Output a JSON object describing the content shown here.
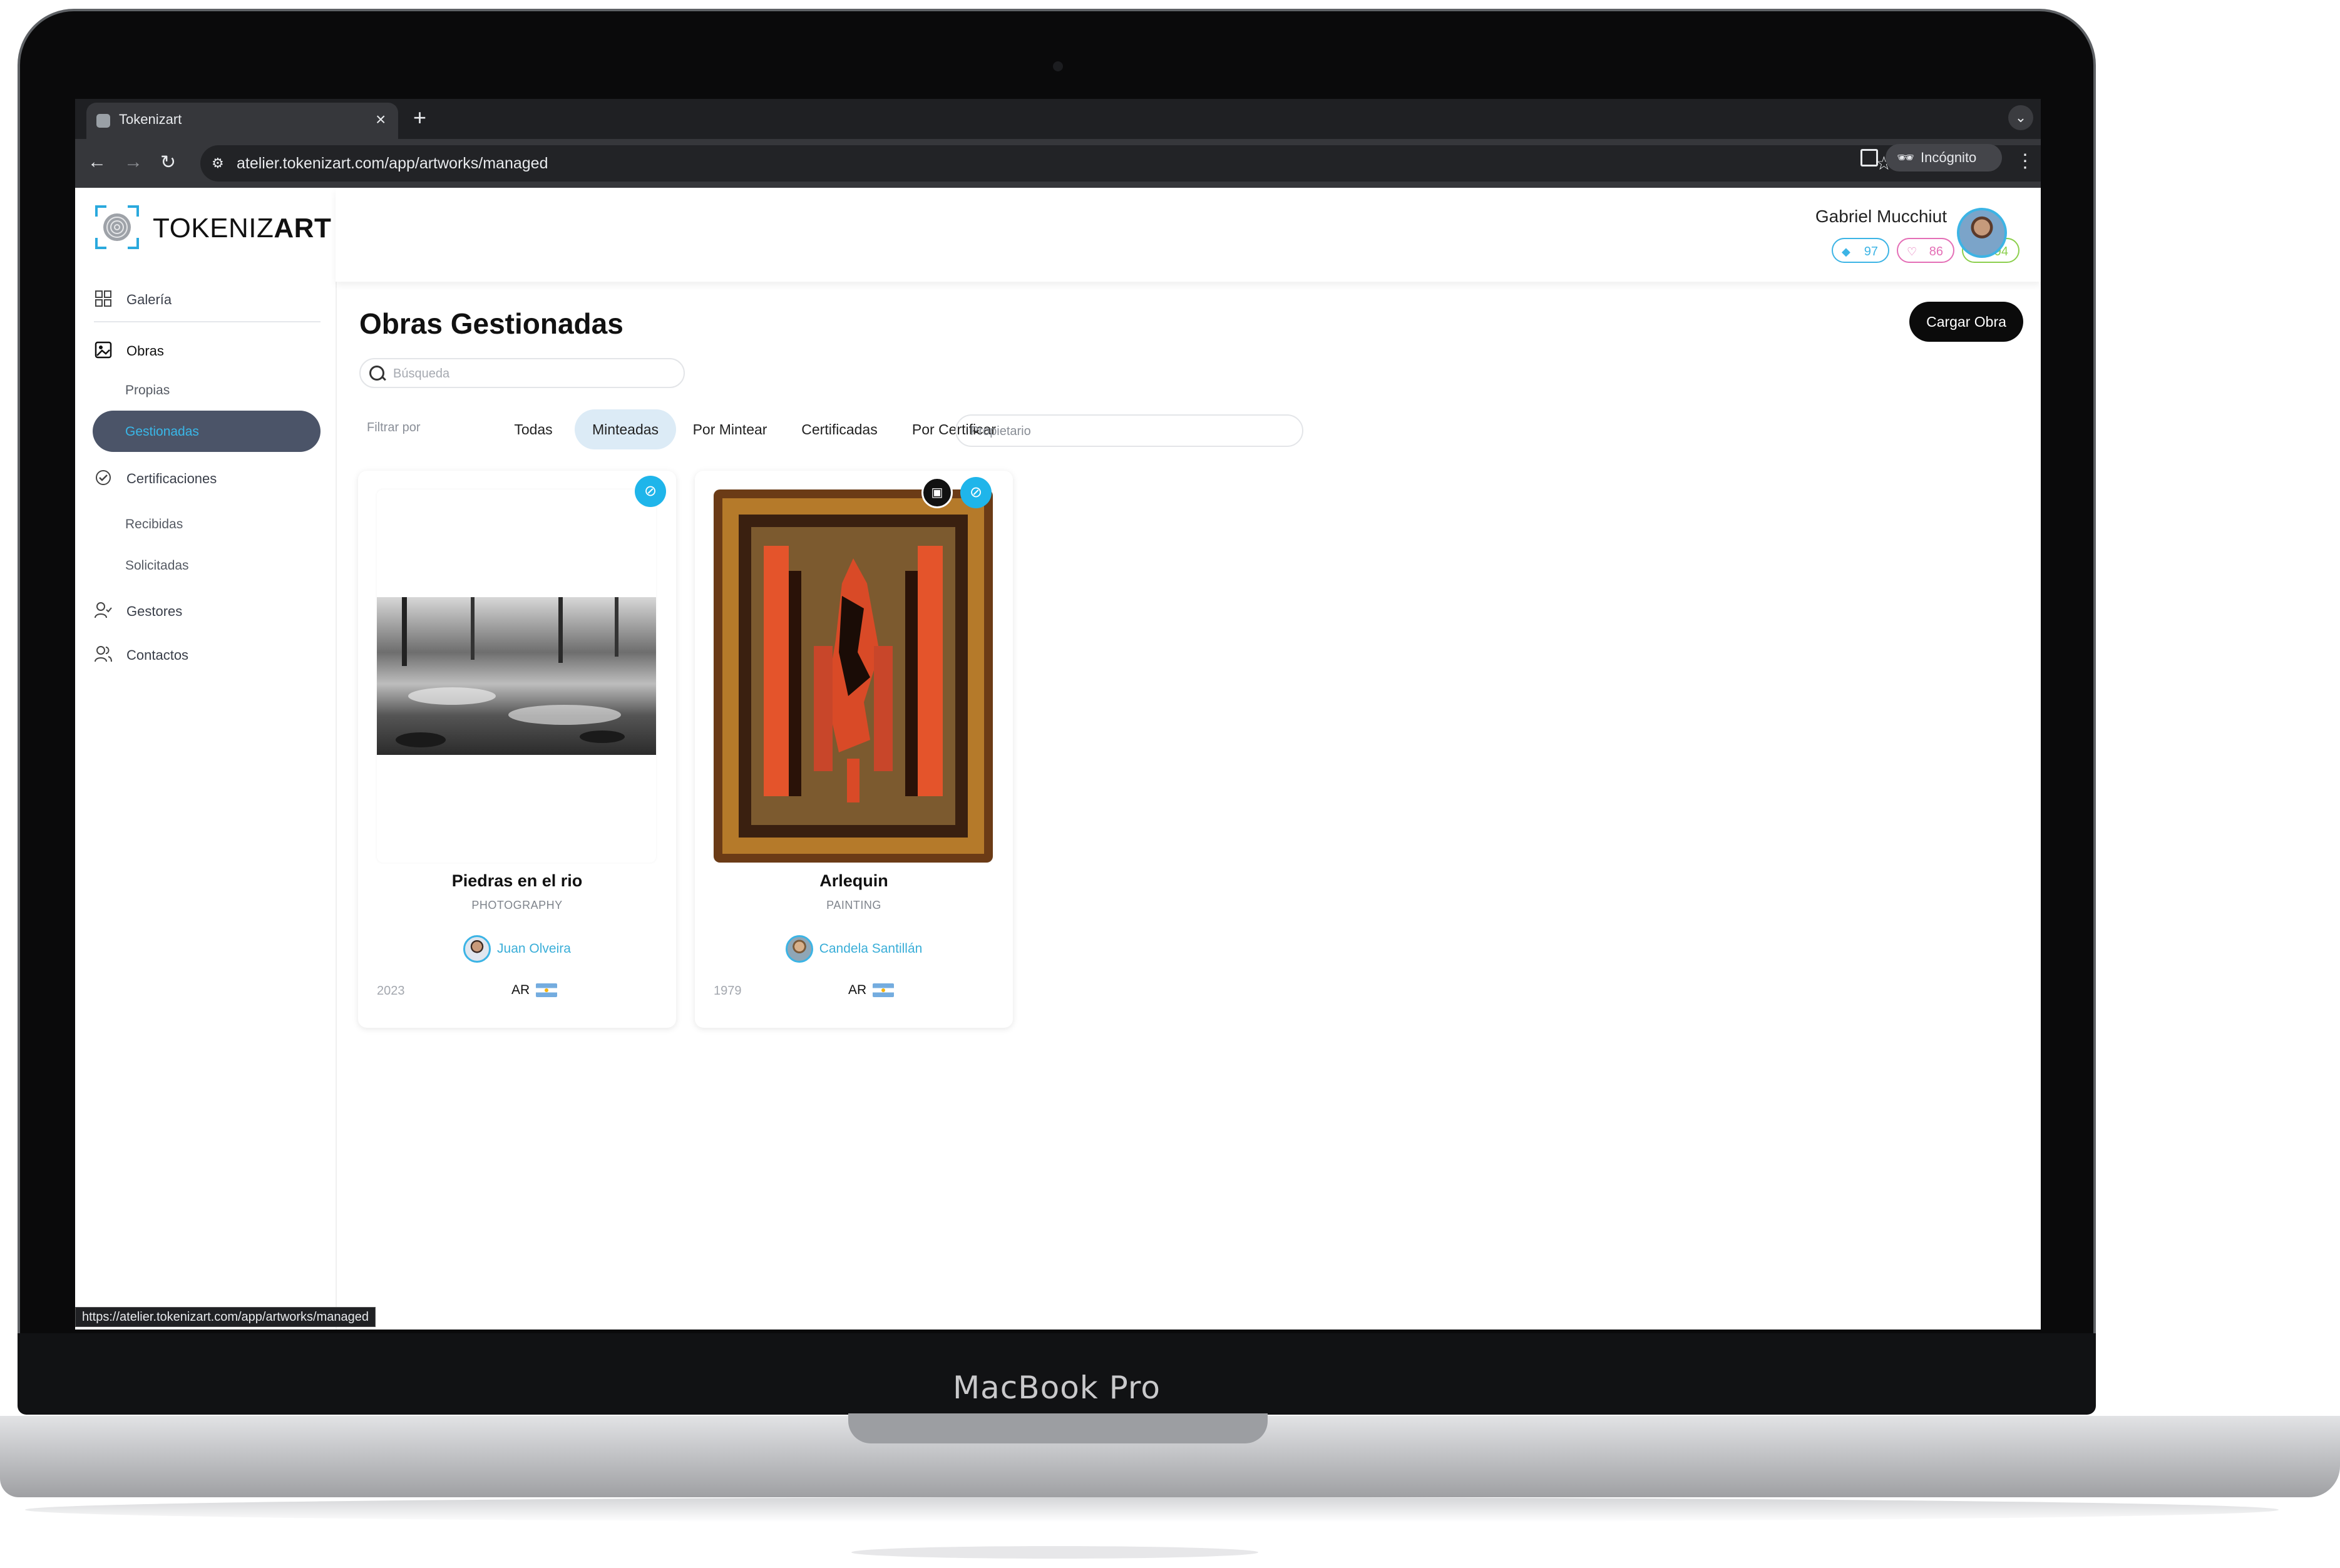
{
  "device": {
    "brand_label": "MacBook Pro"
  },
  "browser": {
    "tab_title": "Tokenizart",
    "url": "atelier.tokenizart.com/app/artworks/managed",
    "incognito_label": "Incógnito",
    "status_url": "https://atelier.tokenizart.com/app/artworks/managed"
  },
  "sidebar": {
    "logo_light": "TOKENIZ",
    "logo_bold": "ART",
    "items": [
      {
        "label": "Galería",
        "icon": "grid-icon"
      },
      {
        "label": "Obras",
        "icon": "image-icon"
      },
      {
        "label": "Propias"
      },
      {
        "label": "Gestionadas",
        "active": true
      },
      {
        "label": "Certificaciones",
        "icon": "check-circle-icon"
      },
      {
        "label": "Recibidas"
      },
      {
        "label": "Solicitadas"
      },
      {
        "label": "Gestores",
        "icon": "user-check-icon"
      },
      {
        "label": "Contactos",
        "icon": "users-icon"
      }
    ]
  },
  "header": {
    "user_name": "Gabriel Mucchiut",
    "stats": [
      {
        "value": "97",
        "color": "#3cb4e5",
        "icon": "tag-icon"
      },
      {
        "value": "86",
        "color": "#e46fb6",
        "icon": "heart-icon"
      },
      {
        "value": "94",
        "color": "#8ccf4d",
        "icon": "handshake-icon"
      }
    ]
  },
  "main": {
    "title": "Obras Gestionadas",
    "upload_button": "Cargar Obra",
    "search_placeholder": "Búsqueda",
    "filter_label": "Filtrar por",
    "filters": [
      "Todas",
      "Minteadas",
      "Por Mintear",
      "Certificadas",
      "Por Certificar"
    ],
    "active_filter": "Minteadas",
    "owner_placeholder": "Propietario"
  },
  "artworks": [
    {
      "title": "Piedras en el rio",
      "category": "PHOTOGRAPHY",
      "artist": "Juan Olveira",
      "year": "2023",
      "country": "AR"
    },
    {
      "title": "Arlequin",
      "category": "PAINTING",
      "artist": "Candela Santillán",
      "year": "1979",
      "country": "AR"
    }
  ],
  "colors": {
    "accent": "#1fb5ea",
    "sidebar_active_bg": "#4b5468",
    "primary_button": "#0b0b0b"
  }
}
